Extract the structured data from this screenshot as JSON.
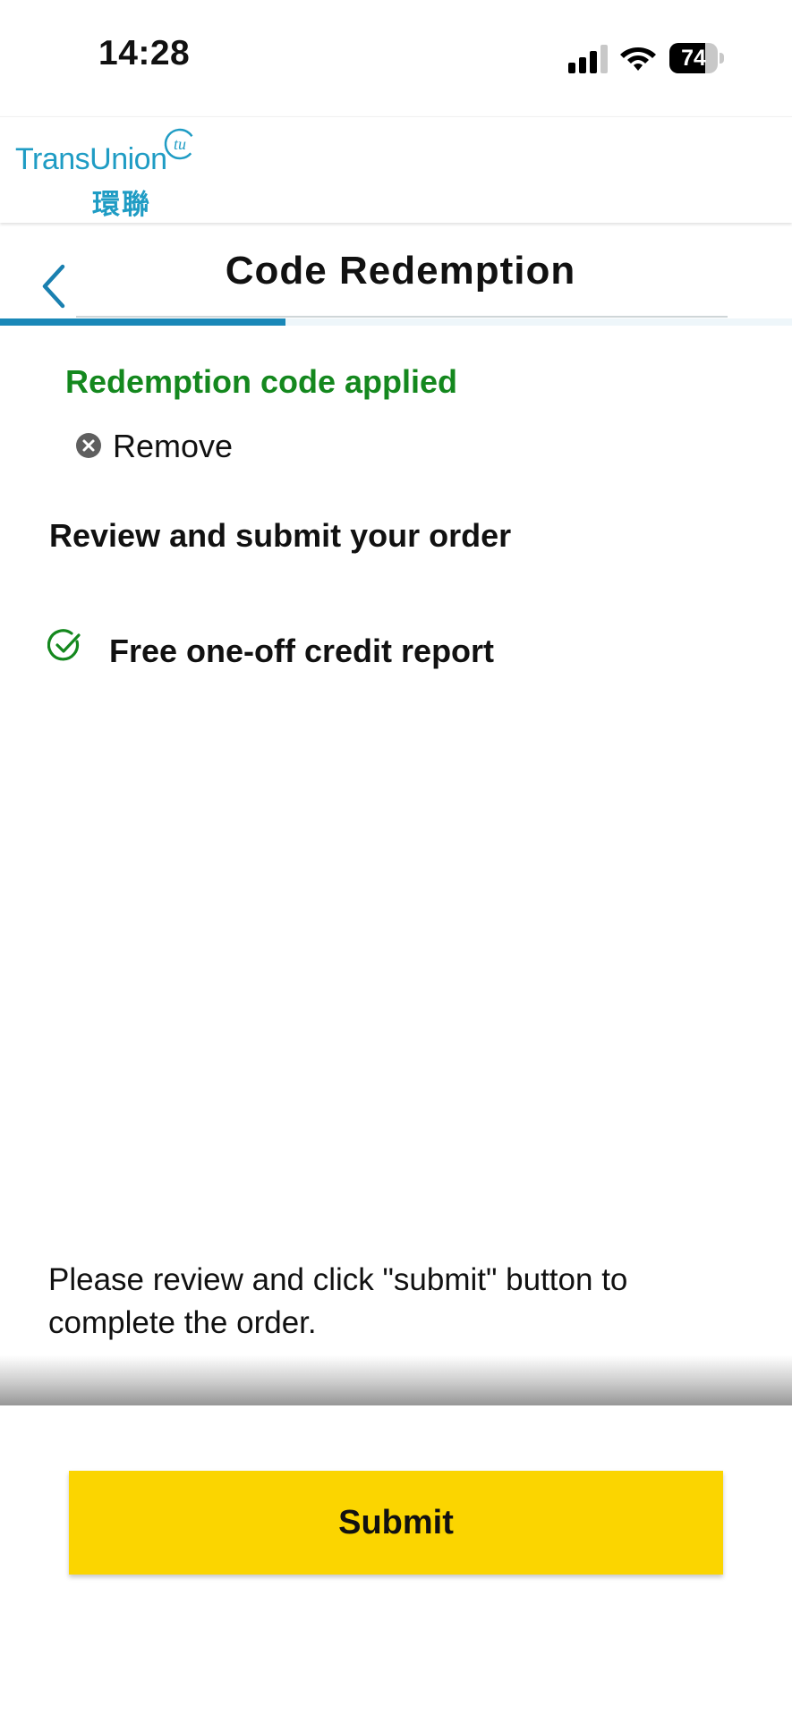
{
  "status_bar": {
    "time": "14:28",
    "battery_percent": "74",
    "battery_level": 0.74,
    "signal_bars": 3,
    "icons": [
      "cellular-signal-icon",
      "wifi-icon",
      "battery-icon"
    ]
  },
  "header": {
    "logo_text": "TransUnion",
    "logo_mark": "tu",
    "logo_chinese": "環聯",
    "brand_color": "#1f9cc4"
  },
  "title_bar": {
    "back_icon": "chevron-left-icon",
    "title": "Code Redemption",
    "progress": 0.36,
    "progress_color": "#1a88b8"
  },
  "redemption": {
    "status_text": "Redemption code applied",
    "status_color": "#14881e",
    "remove_icon": "close-circle-icon",
    "remove_label": "Remove"
  },
  "order": {
    "heading": "Review and submit your order",
    "items": [
      {
        "icon": "check-circle-icon",
        "label": "Free one-off credit report"
      }
    ]
  },
  "instructions": "Please review and click \"submit\" button to complete the order.",
  "footer": {
    "submit_label": "Submit",
    "submit_color": "#fbd500"
  }
}
